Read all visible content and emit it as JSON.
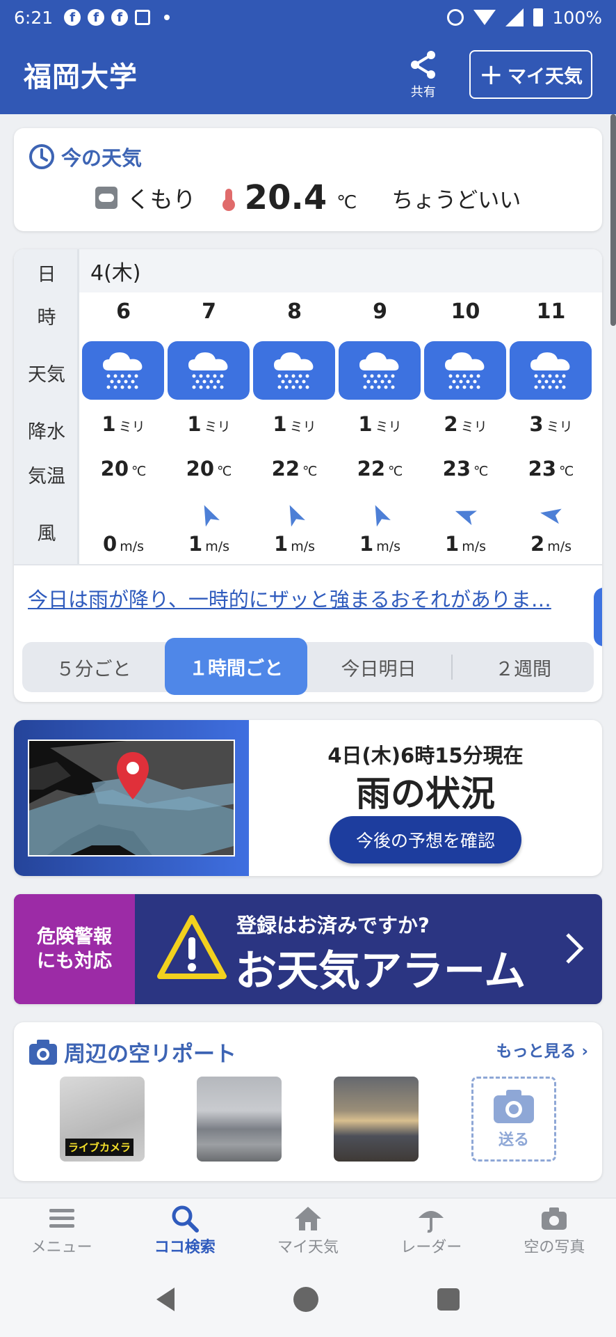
{
  "status_bar": {
    "time": "6:21",
    "battery": "100%"
  },
  "app_bar": {
    "title": "福岡大学",
    "share_label": "共有",
    "my_weather_label": "マイ天気",
    "my_weather_plus": "+"
  },
  "current": {
    "heading": "今の天気",
    "condition": "くもり",
    "temperature": "20.4",
    "unit": "℃",
    "comment": "ちょうどいい"
  },
  "forecast": {
    "row_labels": {
      "day": "日",
      "hour": "時",
      "weather": "天気",
      "precip": "降水",
      "temp": "気温",
      "wind": "風"
    },
    "day": "4(木)",
    "precip_unit": "ミリ",
    "temp_unit": "℃",
    "wind_unit": "m/s",
    "hours": [
      {
        "hour": "6",
        "weather": "rain",
        "precip": "1",
        "temp": "20",
        "wind": "0",
        "wind_dir_deg": null
      },
      {
        "hour": "7",
        "weather": "rain",
        "precip": "1",
        "temp": "20",
        "wind": "1",
        "wind_dir_deg": -25
      },
      {
        "hour": "8",
        "weather": "rain",
        "precip": "1",
        "temp": "22",
        "wind": "1",
        "wind_dir_deg": -25
      },
      {
        "hour": "9",
        "weather": "rain",
        "precip": "1",
        "temp": "22",
        "wind": "1",
        "wind_dir_deg": -25
      },
      {
        "hour": "10",
        "weather": "rain",
        "precip": "2",
        "temp": "23",
        "wind": "1",
        "wind_dir_deg": -70
      },
      {
        "hour": "11",
        "weather": "rain",
        "precip": "3",
        "temp": "23",
        "wind": "2",
        "wind_dir_deg": -80
      }
    ],
    "summary": "今日は雨が降り、一時的にザッと強まるおそれがありま…",
    "tabs": [
      "５分ごと",
      "１時間ごと",
      "今日明日",
      "２週間"
    ],
    "active_tab": 1
  },
  "radar": {
    "time": "4日(木)6時15分現在",
    "title": "雨の状況",
    "button": "今後の予想を確認"
  },
  "alarm": {
    "left_line1": "危険警報",
    "left_line2": "にも対応",
    "question": "登録はお済みですか?",
    "title": "お天気アラーム"
  },
  "sky_report": {
    "heading": "周辺の空リポート",
    "more": "もっと見る",
    "live_tag": "ライブカメラ",
    "send": "送る"
  },
  "bottom_nav": [
    {
      "label": "メニュー",
      "icon": "menu-icon"
    },
    {
      "label": "ココ検索",
      "icon": "search-icon",
      "active": true
    },
    {
      "label": "マイ天気",
      "icon": "home-icon"
    },
    {
      "label": "レーダー",
      "icon": "radar-umbrella-icon"
    },
    {
      "label": "空の写真",
      "icon": "camera-icon"
    }
  ],
  "colors": {
    "primary": "#3158b5",
    "tile_blue": "#3d72e0",
    "link": "#2f5bbd",
    "alarm_purple": "#9c2ba6",
    "alarm_navy": "#2b3582"
  }
}
